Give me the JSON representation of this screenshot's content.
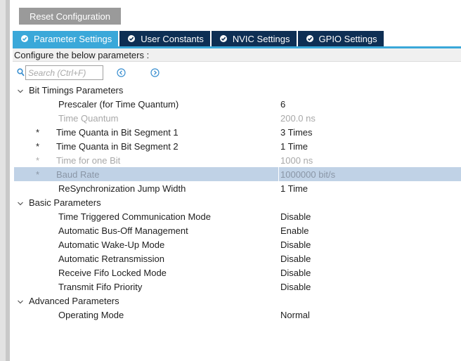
{
  "toolbar": {
    "reset_label": "Reset Configuration"
  },
  "tabs": [
    {
      "label": "Parameter Settings",
      "active": true
    },
    {
      "label": "User Constants",
      "active": false
    },
    {
      "label": "NVIC Settings",
      "active": false
    },
    {
      "label": "GPIO Settings",
      "active": false
    }
  ],
  "configure_text": "Configure the below parameters :",
  "search": {
    "placeholder": "Search (Ctrl+F)",
    "value": ""
  },
  "colors": {
    "accent": "#3aa8d9",
    "tab_dark": "#0e2f54",
    "selection": "#c0d2e6",
    "disabled_text": "#a8a8a8"
  },
  "groups": [
    {
      "label": "Bit Timings Parameters",
      "params": [
        {
          "star": "",
          "name": "Prescaler (for Time Quantum)",
          "value": "6",
          "disabled": false
        },
        {
          "star": "",
          "name": "Time Quantum",
          "value": "200.0 ns",
          "disabled": true
        },
        {
          "star": "*",
          "name": "Time Quanta in Bit Segment 1",
          "value": "3 Times",
          "disabled": false
        },
        {
          "star": "*",
          "name": "Time Quanta in Bit Segment 2",
          "value": "1 Time",
          "disabled": false
        },
        {
          "star": "*",
          "name": "Time for one Bit",
          "value": "1000 ns",
          "disabled": true
        },
        {
          "star": "*",
          "name": "Baud Rate",
          "value": "1000000 bit/s",
          "disabled": true,
          "selected": true
        },
        {
          "star": "",
          "name": "ReSynchronization Jump Width",
          "value": "1 Time",
          "disabled": false
        }
      ]
    },
    {
      "label": "Basic Parameters",
      "params": [
        {
          "star": "",
          "name": "Time Triggered Communication Mode",
          "value": "Disable",
          "disabled": false
        },
        {
          "star": "",
          "name": "Automatic Bus-Off Management",
          "value": "Enable",
          "disabled": false
        },
        {
          "star": "",
          "name": "Automatic Wake-Up Mode",
          "value": "Disable",
          "disabled": false
        },
        {
          "star": "",
          "name": "Automatic Retransmission",
          "value": "Disable",
          "disabled": false
        },
        {
          "star": "",
          "name": "Receive Fifo Locked Mode",
          "value": "Disable",
          "disabled": false
        },
        {
          "star": "",
          "name": "Transmit Fifo Priority",
          "value": "Disable",
          "disabled": false
        }
      ]
    },
    {
      "label": "Advanced Parameters",
      "params": [
        {
          "star": "",
          "name": "Operating Mode",
          "value": "Normal",
          "disabled": false
        }
      ]
    }
  ]
}
